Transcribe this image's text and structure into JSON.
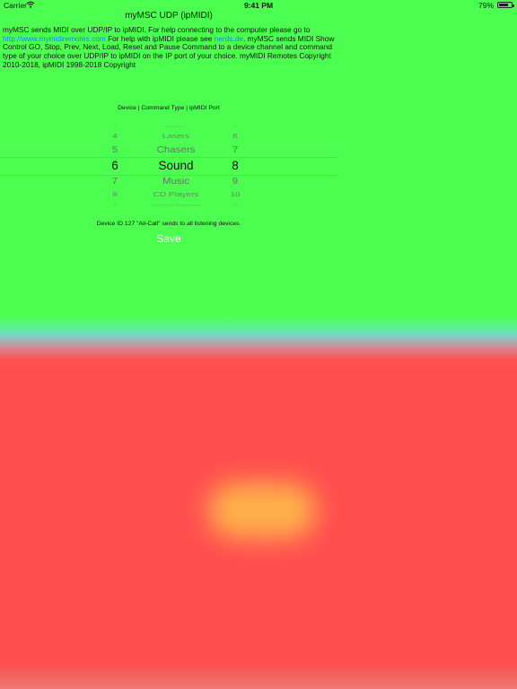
{
  "status_bar": {
    "carrier": "Carrier",
    "time": "9:41 PM",
    "battery": "79%"
  },
  "title": "myMSC UDP (ipMIDI)",
  "description": {
    "text_1": "myMSC sends MIDI over UDP/IP to ipMIDI. For help connecting to the computer please go to ",
    "link_1": "http://www.mymidiremotes.com",
    "text_2": " For help with ipMIDI please see ",
    "link_2": "nerds.de",
    "text_3": ". myMSC sends MIDI Show Control GO, Stop, Prev, Next, Load, Reset and Pause Command to a device channel and command type of your choice over UDP/IP to ipMIDI on the IP port of your choice. myMIDI Remotes Copyright 2010-2018, ipMIDI 1998-2018 Copyright"
  },
  "picker": {
    "header": "Device | Command Type | ipMIDI Port",
    "rows": [
      {
        "device": "3",
        "command": "Strobes",
        "port": "5"
      },
      {
        "device": "4",
        "command": "Lasers",
        "port": "6"
      },
      {
        "device": "5",
        "command": "Chasers",
        "port": "7"
      },
      {
        "device": "6",
        "command": "Sound",
        "port": "8"
      },
      {
        "device": "7",
        "command": "Music",
        "port": "9"
      },
      {
        "device": "8",
        "command": "CD Players",
        "port": "10"
      },
      {
        "device": "9",
        "command": "EPROM Playback",
        "port": "11"
      }
    ],
    "selected_index": 3
  },
  "note": "Device ID 127 \"All-Call\" sends to all listening devices.",
  "save_label": "Save",
  "colors": {
    "top_background": "#4cfe50",
    "bottom_background": "#ff4f4f",
    "link": "#0a84ff"
  }
}
